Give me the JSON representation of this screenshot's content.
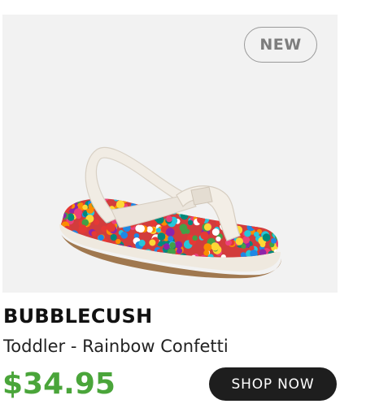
{
  "product": {
    "badge": "NEW",
    "brand": "BUBBLECUSH",
    "subtitle": "Toddler - Rainbow Confetti",
    "price": "$34.95",
    "cta_label": "SHOP NOW",
    "image_subject": "toddler-sandal-rainbow-confetti"
  },
  "colors": {
    "price": "#4aa53a",
    "button_bg": "#1e1e1e",
    "panel_bg": "#f2f2f2",
    "confetti": [
      "#e53935",
      "#fb8c00",
      "#fdd835",
      "#43a047",
      "#1e88e5",
      "#8e24aa",
      "#ec407a",
      "#26c6da",
      "#ffffff",
      "#00897b"
    ]
  }
}
